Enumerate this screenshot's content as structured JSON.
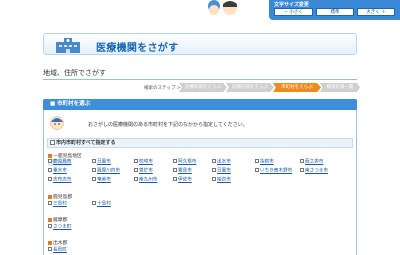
{
  "header": {
    "font_size_label": "文字サイズ変更",
    "font_small": "小さく",
    "font_standard": "標準",
    "font_large": "大きく"
  },
  "banner": {
    "title": "医療機関をさがす"
  },
  "page": {
    "title": "地域、住所でさがす"
  },
  "steps": {
    "label": "検索のステップ",
    "items": [
      "診療科目をえらぶ",
      "診療内容をえらぶ",
      "市町村をえらぶ",
      "検索結果一覧"
    ],
    "active_index": 2
  },
  "section": {
    "header": "市町村を選ぶ",
    "intro": "おさがしの医療機関のある市町村を下記のなかから指定してください。",
    "select_all": "市内市町村すべて指定する"
  },
  "regions": [
    {
      "name": "鹿児島地区",
      "cities": [
        [
          "鹿児島市",
          "日置市",
          "枕崎市",
          "阿久根市",
          "出水市",
          "指宿市",
          "西之表市"
        ],
        [
          "垂水市",
          "薩摩川内市",
          "曽於市",
          "霧島市",
          "日置市",
          "いちき串木野市",
          "南さつま市"
        ],
        [
          "志布志市",
          "奄美市",
          "南九州市",
          "伊佐市",
          "姶良市"
        ]
      ]
    },
    {
      "name": "鹿児島郡",
      "cities": [
        [
          "三島村",
          "十島村"
        ]
      ]
    },
    {
      "name": "薩摩郡",
      "cities": [
        [
          "さつま町"
        ]
      ]
    },
    {
      "name": "出水郡",
      "cities": [
        [
          "長島町"
        ]
      ]
    }
  ],
  "colors": {
    "accent": "#3f8fd8",
    "active_step": "#ef8a1f",
    "title": "#1a67b5"
  }
}
